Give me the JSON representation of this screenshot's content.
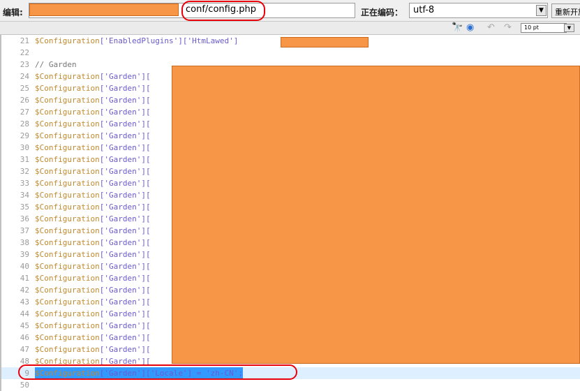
{
  "toolbar": {
    "edit_label": "编辑:",
    "path_text": "conf/config.php",
    "encoding_label": "正在编码：",
    "encoding_value": "utf-8",
    "reload_label": "重新开放",
    "font_size": "10 pt"
  },
  "editor": {
    "lines": [
      {
        "num": "21",
        "var": "$Configuration",
        "rest": "['EnabledPlugins']['HtmLawed']"
      },
      {
        "num": "22",
        "var": "",
        "rest": ""
      },
      {
        "num": "23",
        "comment": "// Garden"
      },
      {
        "num": "24",
        "var": "$Configuration",
        "rest": "['Garden']["
      },
      {
        "num": "25",
        "var": "$Configuration",
        "rest": "['Garden']["
      },
      {
        "num": "26",
        "var": "$Configuration",
        "rest": "['Garden']["
      },
      {
        "num": "27",
        "var": "$Configuration",
        "rest": "['Garden']["
      },
      {
        "num": "28",
        "var": "$Configuration",
        "rest": "['Garden']["
      },
      {
        "num": "29",
        "var": "$Configuration",
        "rest": "['Garden']["
      },
      {
        "num": "30",
        "var": "$Configuration",
        "rest": "['Garden']["
      },
      {
        "num": "31",
        "var": "$Configuration",
        "rest": "['Garden']["
      },
      {
        "num": "32",
        "var": "$Configuration",
        "rest": "['Garden']["
      },
      {
        "num": "33",
        "var": "$Configuration",
        "rest": "['Garden']["
      },
      {
        "num": "34",
        "var": "$Configuration",
        "rest": "['Garden']["
      },
      {
        "num": "35",
        "var": "$Configuration",
        "rest": "['Garden']["
      },
      {
        "num": "36",
        "var": "$Configuration",
        "rest": "['Garden']["
      },
      {
        "num": "37",
        "var": "$Configuration",
        "rest": "['Garden']["
      },
      {
        "num": "38",
        "var": "$Configuration",
        "rest": "['Garden']["
      },
      {
        "num": "39",
        "var": "$Configuration",
        "rest": "['Garden']["
      },
      {
        "num": "40",
        "var": "$Configuration",
        "rest": "['Garden']["
      },
      {
        "num": "41",
        "var": "$Configuration",
        "rest": "['Garden']["
      },
      {
        "num": "42",
        "var": "$Configuration",
        "rest": "['Garden']["
      },
      {
        "num": "43",
        "var": "$Configuration",
        "rest": "['Garden']["
      },
      {
        "num": "44",
        "var": "$Configuration",
        "rest": "['Garden']["
      },
      {
        "num": "45",
        "var": "$Configuration",
        "rest": "['Garden']["
      },
      {
        "num": "46",
        "var": "$Configuration",
        "rest": "['Garden']["
      },
      {
        "num": "47",
        "var": "$Configuration",
        "rest": "['Garden']["
      },
      {
        "num": "48",
        "var": "$Configuration",
        "rest": "['Garden']["
      },
      {
        "num": "9",
        "var": "$Configuration",
        "rest": "['Garden']['Locale'] = 'zh-CN';",
        "selected": true
      },
      {
        "num": "50",
        "var": "",
        "rest": ""
      }
    ]
  }
}
